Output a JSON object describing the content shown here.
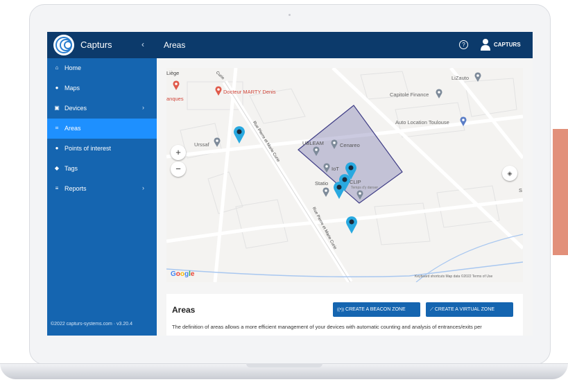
{
  "app": {
    "name": "Capturs",
    "collapse_icon": "‹"
  },
  "sidebar": {
    "items": [
      {
        "label": "Home",
        "icon": "home-icon",
        "glyph": "⌂",
        "chevron": ""
      },
      {
        "label": "Maps",
        "icon": "map-marker-icon",
        "glyph": "●",
        "chevron": ""
      },
      {
        "label": "Devices",
        "icon": "devices-icon",
        "glyph": "▣",
        "chevron": "›"
      },
      {
        "label": "Areas",
        "icon": "areas-icon",
        "glyph": "⌗",
        "chevron": ""
      },
      {
        "label": "Points of interest",
        "icon": "poi-icon",
        "glyph": "●",
        "chevron": ""
      },
      {
        "label": "Tags",
        "icon": "tag-icon",
        "glyph": "◆",
        "chevron": ""
      },
      {
        "label": "Reports",
        "icon": "reports-icon",
        "glyph": "≡",
        "chevron": "›"
      }
    ],
    "active": "Areas",
    "footer": "©2022 capturs-systems.com · v3.20.4"
  },
  "topbar": {
    "title": "Areas",
    "help_icon": "?",
    "user": "CAPTURS"
  },
  "map": {
    "labels": {
      "liege": "Liège",
      "marty": "Docteur MARTY Denis",
      "banques": "anques",
      "lizauto": "LiZauto",
      "capitole": "Capitole Finance",
      "autolocation": "Auto Location Toulouse",
      "urssaf": "Urssaf",
      "ubleam": "UBLEAM",
      "cenareo": "Cenareo",
      "iot": "IoT",
      "statio": "Statio",
      "clip": "CLIP",
      "tempsdescorps": "Temps d'y danser",
      "street_upper": "Rue Pierre et Marie Curie",
      "street_lower": "Rue Pierre et Marie Curie",
      "street_top": "Curie",
      "edge_s": "S"
    },
    "zoom_in": "+",
    "zoom_out": "−",
    "layers_icon": "◈",
    "google": [
      "G",
      "o",
      "o",
      "g",
      "l",
      "e"
    ],
    "google_colors": [
      "#4285f4",
      "#ea4335",
      "#fbbc05",
      "#4285f4",
      "#34a853",
      "#ea4335"
    ],
    "attribution": "Keyboard shortcuts   Map data ©2022   Terms of Use",
    "zone_color": "#5c5a9e",
    "pin_color": "#29a9e0"
  },
  "panel": {
    "title": "Areas",
    "beacon_button": "CREATE A BEACON ZONE",
    "beacon_icon": "((•))",
    "virtual_button": "CREATE A VIRTUAL ZONE",
    "virtual_icon": "⟋",
    "description": "The definition of areas allows a more efficient management of your devices with automatic counting and analysis of entrances/exits per"
  }
}
